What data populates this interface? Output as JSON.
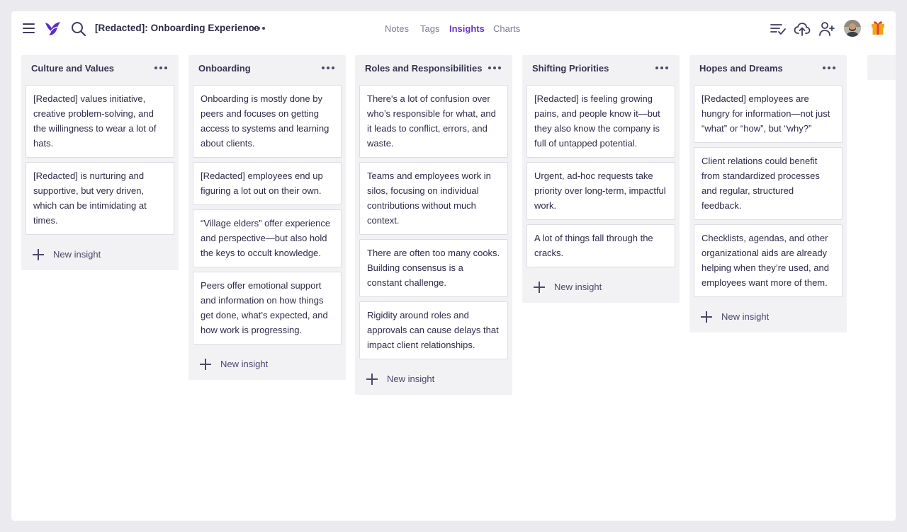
{
  "header": {
    "document_title": "[Redacted]: Onboarding Experience",
    "tabs": [
      {
        "label": "Notes"
      },
      {
        "label": "Tags"
      },
      {
        "label": "Insights"
      },
      {
        "label": "Charts"
      }
    ],
    "active_tab": "Insights",
    "icons": [
      "menu-icon",
      "logo-icon",
      "search-icon",
      "more-icon",
      "checklist-icon",
      "upload-icon",
      "add-user-icon",
      "avatar",
      "gift-icon"
    ]
  },
  "colors": {
    "accent": "#6a35c9",
    "background": "#ebeaef",
    "column_background": "#f2f2f5",
    "card_background": "#ffffff",
    "gift": "#f2a51c"
  },
  "columns": [
    {
      "title": "Culture and Values",
      "cards": [
        "[Redacted] values initiative, creative problem-solving, and the willingness to wear a lot of hats.",
        "[Redacted] is nurturing and supportive, but very driven, which can be intimidating at times."
      ],
      "new_label": "New insight"
    },
    {
      "title": "Onboarding",
      "cards": [
        "Onboarding is mostly done by peers and focuses on getting access to systems and learning about clients.",
        "[Redacted] employees end up figuring a lot out on their own.",
        "“Village elders” offer experience and perspective—but also hold the keys to occult knowledge.",
        "Peers offer emotional support and information on how things get done, what’s expected, and how work is progressing."
      ],
      "new_label": "New insight"
    },
    {
      "title": "Roles and Responsibilities",
      "cards": [
        "There's a lot of confusion over who’s responsible for what, and it leads to conflict, errors, and waste.",
        "Teams and employees work in silos, focusing on individual contributions without much context.",
        "There are often too many cooks. Building consensus is a constant challenge.",
        "Rigidity around roles and approvals can cause delays that impact client relationships."
      ],
      "new_label": "New insight"
    },
    {
      "title": "Shifting Priorities",
      "cards": [
        "[Redacted] is feeling growing pains, and people know it—but they also know the company is full of untapped potential.",
        "Urgent, ad-hoc requests take priority over long-term, impactful work.",
        "A lot of things fall through the cracks."
      ],
      "new_label": "New insight"
    },
    {
      "title": "Hopes and Dreams",
      "cards": [
        "[Redacted] employees are hungry for information—not just “what” or “how”, but “why?”",
        "Client relations could benefit from standardized processes and regular, structured feedback.",
        "Checklists, agendas, and other organizational aids are already helping when they’re used, and employees want more of them."
      ],
      "new_label": "New insight"
    }
  ]
}
